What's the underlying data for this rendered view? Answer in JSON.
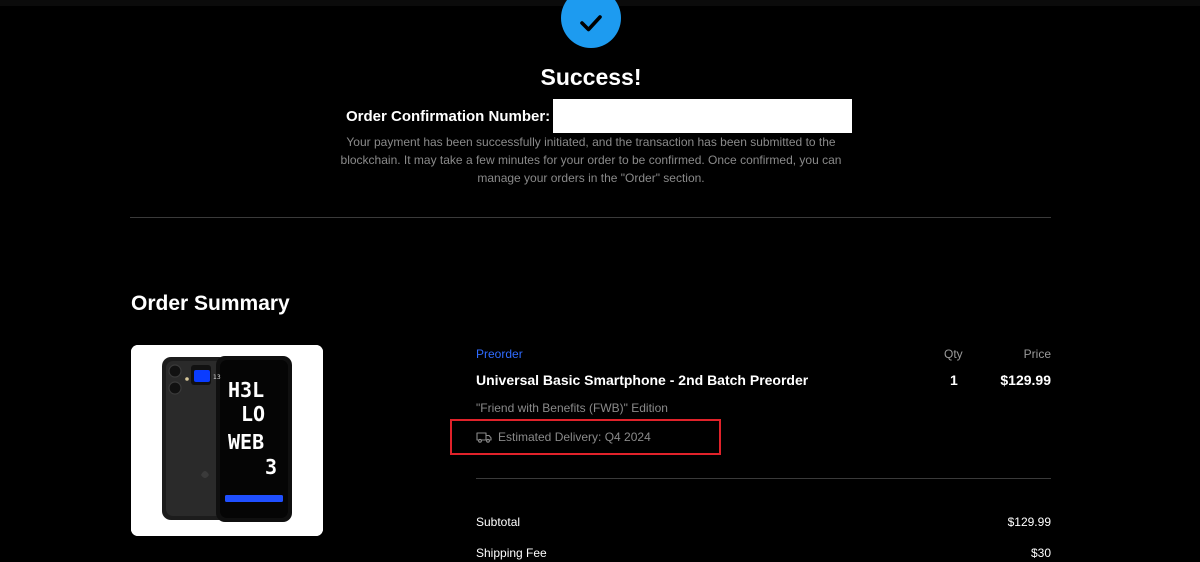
{
  "confirmation": {
    "title": "Success!",
    "order_number_label": "Order Confirmation Number:",
    "order_number_value": "",
    "message": "Your payment has been successfully initiated, and the transaction has been submitted to the blockchain. It may take a few minutes for your order to be confirmed. Once confirmed, you can manage your orders in the \"Order\" section."
  },
  "summary": {
    "title": "Order Summary",
    "columns": {
      "qty": "Qty",
      "price": "Price"
    },
    "item": {
      "tag": "Preorder",
      "name": "Universal Basic Smartphone - 2nd Batch Preorder",
      "edition": "\"Friend with Benefits (FWB)\" Edition",
      "delivery": "Estimated Delivery: Q4 2024",
      "qty": "1",
      "price": "$129.99",
      "image_screen_text": [
        "H3L",
        "LO",
        "WEB",
        "3"
      ],
      "image_status_number": "13"
    },
    "totals": {
      "subtotal_label": "Subtotal",
      "subtotal_value": "$129.99",
      "shipping_label": "Shipping Fee",
      "shipping_value": "$30"
    }
  },
  "colors": {
    "accent": "#1d9bf0",
    "preorder_tag": "#2f6bff",
    "highlight": "#e0222a"
  },
  "icons": {
    "success": "checkmark-icon",
    "delivery": "truck-icon"
  }
}
